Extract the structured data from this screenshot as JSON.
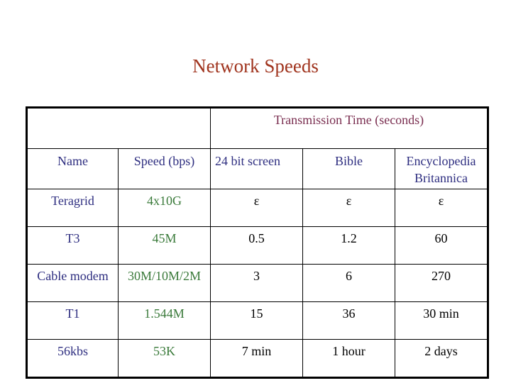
{
  "title": "Network Speeds",
  "table": {
    "group_header": "Transmission Time (seconds)",
    "columns": [
      "Name",
      "Speed (bps)",
      "24 bit screen",
      "Bible",
      "Encyclopedia Britannica"
    ],
    "rows": [
      {
        "name": "Teragrid",
        "speed": "4x10G",
        "screen": "ε",
        "bible": "ε",
        "britannica": "ε"
      },
      {
        "name": "T3",
        "speed": "45M",
        "screen": "0.5",
        "bible": "1.2",
        "britannica": "60"
      },
      {
        "name": "Cable modem",
        "speed": "30M/10M/2M",
        "screen": "3",
        "bible": "6",
        "britannica": "270"
      },
      {
        "name": "T1",
        "speed": "1.544M",
        "screen": "15",
        "bible": "36",
        "britannica": "30 min"
      },
      {
        "name": "56kbs",
        "speed": "53K",
        "screen": "7 min",
        "bible": "1 hour",
        "britannica": "2 days"
      }
    ]
  },
  "colors": {
    "title": "#a0341e",
    "group_header": "#7a2e50",
    "header_text": "#2e2e80",
    "speed_text": "#3a7a3a",
    "value_text": "#000000"
  }
}
